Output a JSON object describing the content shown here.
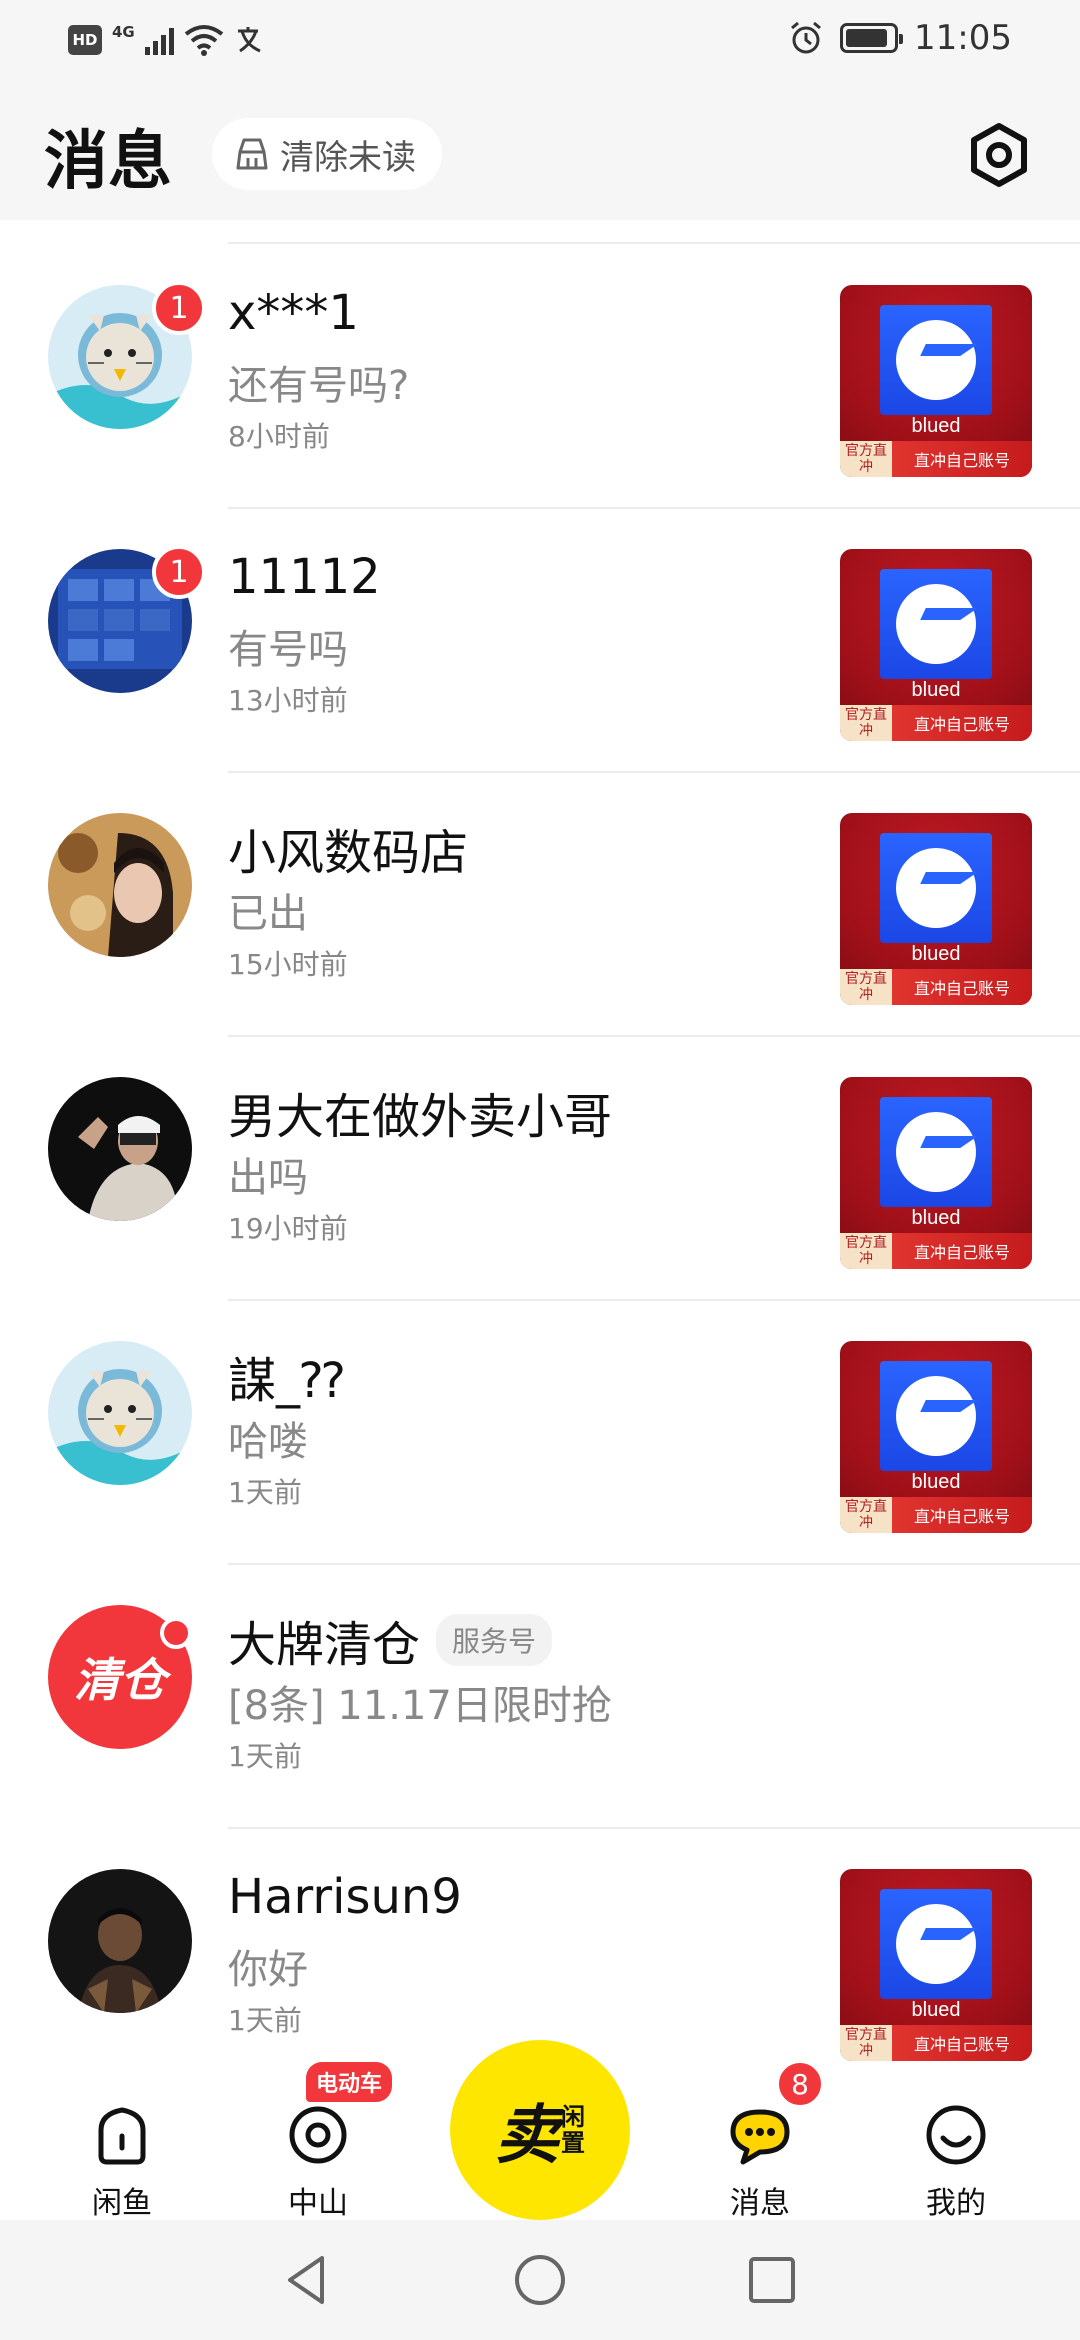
{
  "status_bar": {
    "hd": "HD",
    "network": "4G",
    "time": "11:05",
    "battery_level": 0.9
  },
  "header": {
    "title": "消息",
    "clear_unread": "清除未读"
  },
  "conversations": [
    {
      "name": "x***1",
      "message": "还有号吗?",
      "time": "8小时前",
      "unread": "1",
      "avatar": "cat-avatar",
      "thumb_label": "blued",
      "thumb_tag": "官方直冲",
      "thumb_caption": "直冲自己账号"
    },
    {
      "name": "11112",
      "message": " 有号吗",
      "time": "13小时前",
      "unread": "1",
      "avatar": "photo-avatar-blue",
      "thumb_label": "blued",
      "thumb_tag": "官方直冲",
      "thumb_caption": "直冲自己账号"
    },
    {
      "name": "小风数码店",
      "message": "已出",
      "time": "15小时前",
      "avatar": "photo-avatar-girl",
      "thumb_label": "blued",
      "thumb_tag": "官方直冲",
      "thumb_caption": "直冲自己账号"
    },
    {
      "name": "男大在做外卖小哥",
      "message": "出吗",
      "time": "19小时前",
      "avatar": "photo-avatar-man",
      "thumb_label": "blued",
      "thumb_tag": "官方直冲",
      "thumb_caption": "直冲自己账号"
    },
    {
      "name": "謀_⁇",
      "message": "哈喽",
      "time": "1天前",
      "avatar": "cat-avatar",
      "thumb_label": "blued",
      "thumb_tag": "官方直冲",
      "thumb_caption": "直冲自己账号"
    },
    {
      "name": "大牌清仓",
      "tag": "服务号",
      "message": "[8条] 11.17日限时抢",
      "time": "1天前",
      "avatar_text": "清仓",
      "avatar": "red-logo"
    },
    {
      "name": "Harrisun9",
      "message": "你好",
      "time": "1天前",
      "avatar": "photo-avatar-dark",
      "thumb_label": "blued",
      "thumb_tag": "官方直冲",
      "thumb_caption": "直冲自己账号"
    }
  ],
  "bottom_nav": {
    "home": "闲鱼",
    "local": "中山",
    "local_tag": "电动车",
    "sell_main": "卖",
    "sell_sub_1": "闲",
    "sell_sub_2": "置",
    "messages": "消息",
    "messages_badge": "8",
    "mine": "我的"
  },
  "colors": {
    "accent_yellow": "#ffe600",
    "badge_red": "#f2373c"
  }
}
